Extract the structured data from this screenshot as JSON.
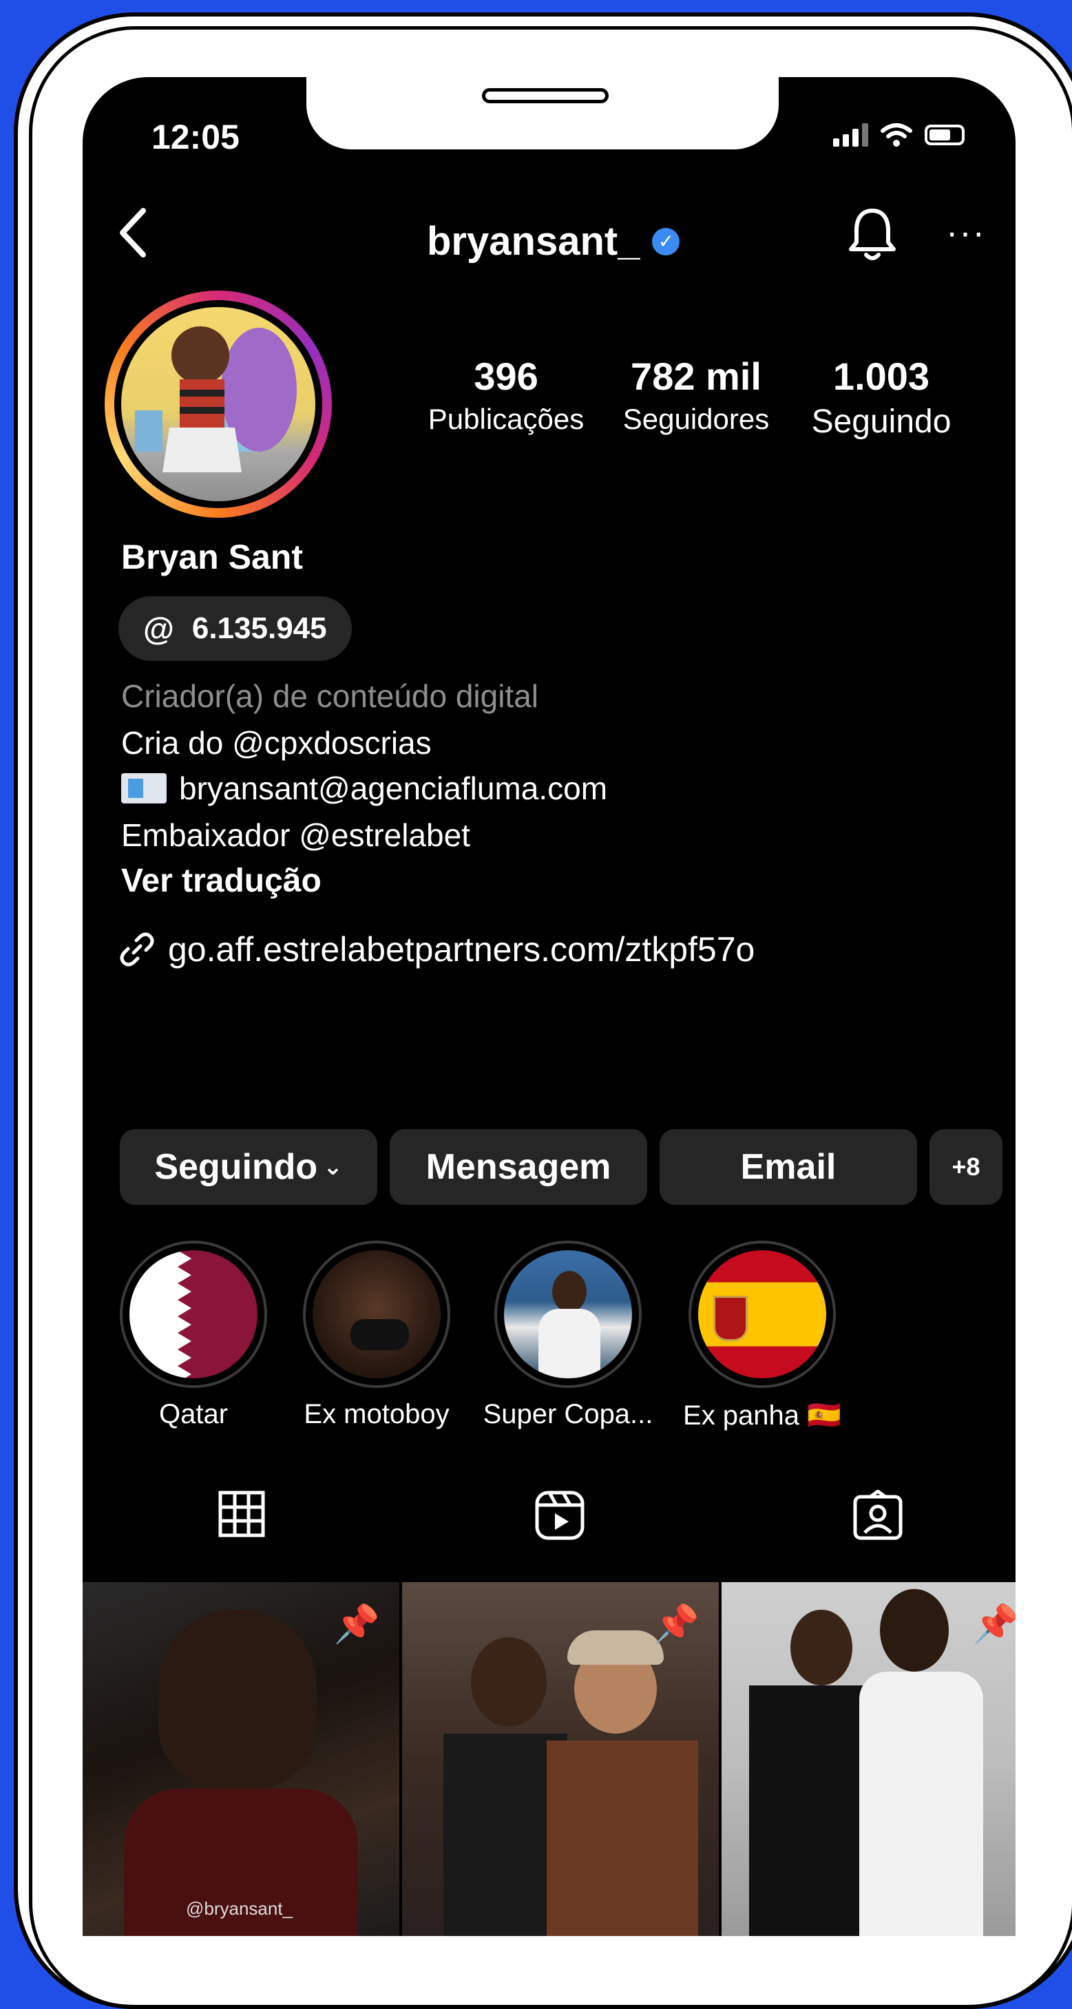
{
  "status_bar": {
    "time": "12:05"
  },
  "header": {
    "username": "bryansant_",
    "verified_icon": "verified-badge-icon"
  },
  "stats": [
    {
      "value": "396",
      "label": "Publicações"
    },
    {
      "value": "782 mil",
      "label": "Seguidores"
    },
    {
      "value": "1.003",
      "label": "Seguindo"
    }
  ],
  "profile": {
    "display_name": "Bryan Sant",
    "threads_count": "6.135.945",
    "category": "Criador(a) de conteúdo digital",
    "bio_line1": "Cria do @cpxdoscrias",
    "bio_email": "bryansant@agenciafluma.com",
    "bio_line3": "Embaixador @estrelabet",
    "translate_label": "Ver tradução",
    "link": "go.aff.estrelabetpartners.com/ztkpf57o"
  },
  "actions": {
    "following_label": "Seguindo",
    "message_label": "Mensagem",
    "email_label": "Email",
    "add_person_label": "+8"
  },
  "highlights": [
    {
      "label": "Qatar"
    },
    {
      "label": "Ex motoboy"
    },
    {
      "label": "Super Copa..."
    },
    {
      "label": "Ex panha 🇪🇸"
    }
  ],
  "tabs": [
    "grid-icon",
    "reels-icon",
    "tagged-icon"
  ],
  "posts": [
    {
      "watermark": "@bryansant_",
      "pinned": true
    },
    {
      "watermark": "",
      "pinned": true
    },
    {
      "watermark": "",
      "pinned": true
    }
  ],
  "colors": {
    "background": "#1f4fe6",
    "screen": "#000000",
    "button": "#262626",
    "verified": "#3b8bf5",
    "muted_text": "#8e8e8e"
  }
}
